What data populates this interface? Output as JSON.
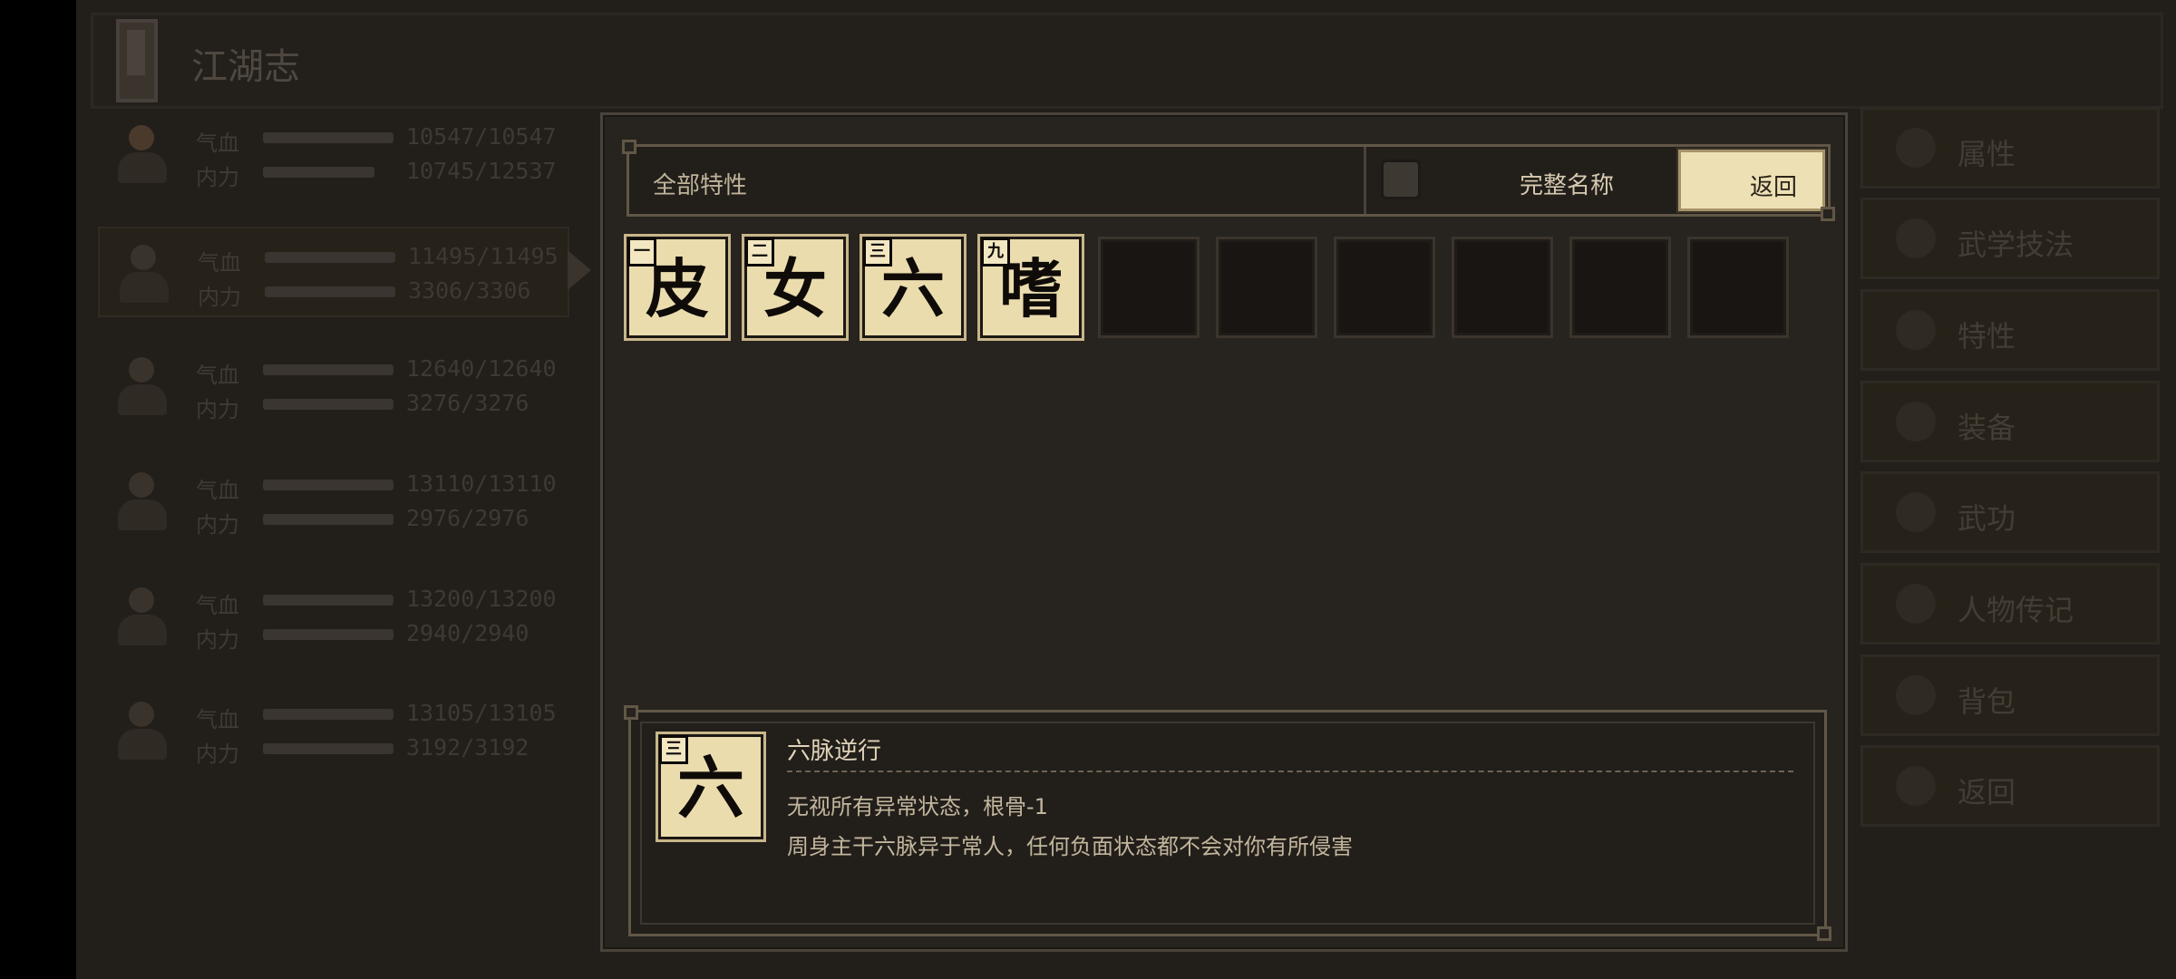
{
  "background": {
    "title": "江湖志",
    "roster": [
      {
        "hp_label": "气血",
        "hp": "10547/10547",
        "hp_fill": 1.0,
        "mp_label": "内力",
        "mp": "10745/12537",
        "mp_fill": 0.857
      },
      {
        "hp_label": "气血",
        "hp": "11495/11495",
        "hp_fill": 1.0,
        "mp_label": "内力",
        "mp": "3306/3306",
        "mp_fill": 1.0
      },
      {
        "hp_label": "气血",
        "hp": "12640/12640",
        "hp_fill": 1.0,
        "mp_label": "内力",
        "mp": "3276/3276",
        "mp_fill": 1.0
      },
      {
        "hp_label": "气血",
        "hp": "13110/13110",
        "hp_fill": 1.0,
        "mp_label": "内力",
        "mp": "2976/2976",
        "mp_fill": 1.0
      },
      {
        "hp_label": "气血",
        "hp": "13200/13200",
        "hp_fill": 1.0,
        "mp_label": "内力",
        "mp": "2940/2940",
        "mp_fill": 1.0
      },
      {
        "hp_label": "气血",
        "hp": "13105/13105",
        "hp_fill": 1.0,
        "mp_label": "内力",
        "mp": "3192/3192",
        "mp_fill": 1.0
      }
    ],
    "menu": [
      "属性",
      "武学技法",
      "特性",
      "装备",
      "武功",
      "人物传记",
      "背包",
      "返回"
    ]
  },
  "modal": {
    "filter_label": "全部特性",
    "full_name_label": "完整名称",
    "full_name_checked": false,
    "back_label": "返回",
    "traits": [
      {
        "char": "皮",
        "rank": "一"
      },
      {
        "char": "女",
        "rank": "二"
      },
      {
        "char": "六",
        "rank": "三"
      },
      {
        "char": "嗜",
        "rank": "九"
      }
    ],
    "detail": {
      "char": "六",
      "rank": "三",
      "name": "六脉逆行",
      "effect": "无视所有异常状态，根骨-1",
      "description": "周身主干六脉异于常人，任何负面状态都不会对你有所侵害"
    }
  },
  "colors": {
    "tile_bg": "#ebdcae",
    "button_bg": "#ede0b4",
    "panel_border": "#615746",
    "modal_bg": "#27231e"
  }
}
